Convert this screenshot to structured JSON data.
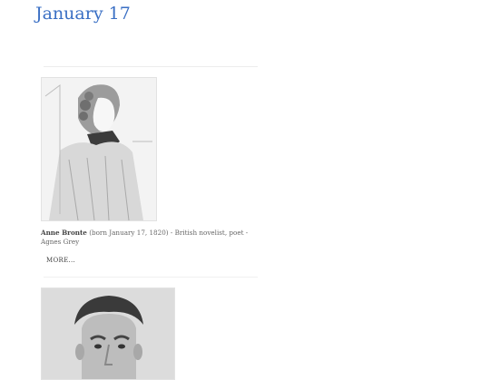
{
  "page": {
    "title": "January 17"
  },
  "entries": [
    {
      "name": "Anne Bronte",
      "details": "(born January 17, 1820) - British novelist, poet - Agnes Grey",
      "more_label": "MORE...",
      "image_alt": "Portrait of Anne Bronte"
    },
    {
      "image_alt": "Portrait photograph"
    }
  ]
}
